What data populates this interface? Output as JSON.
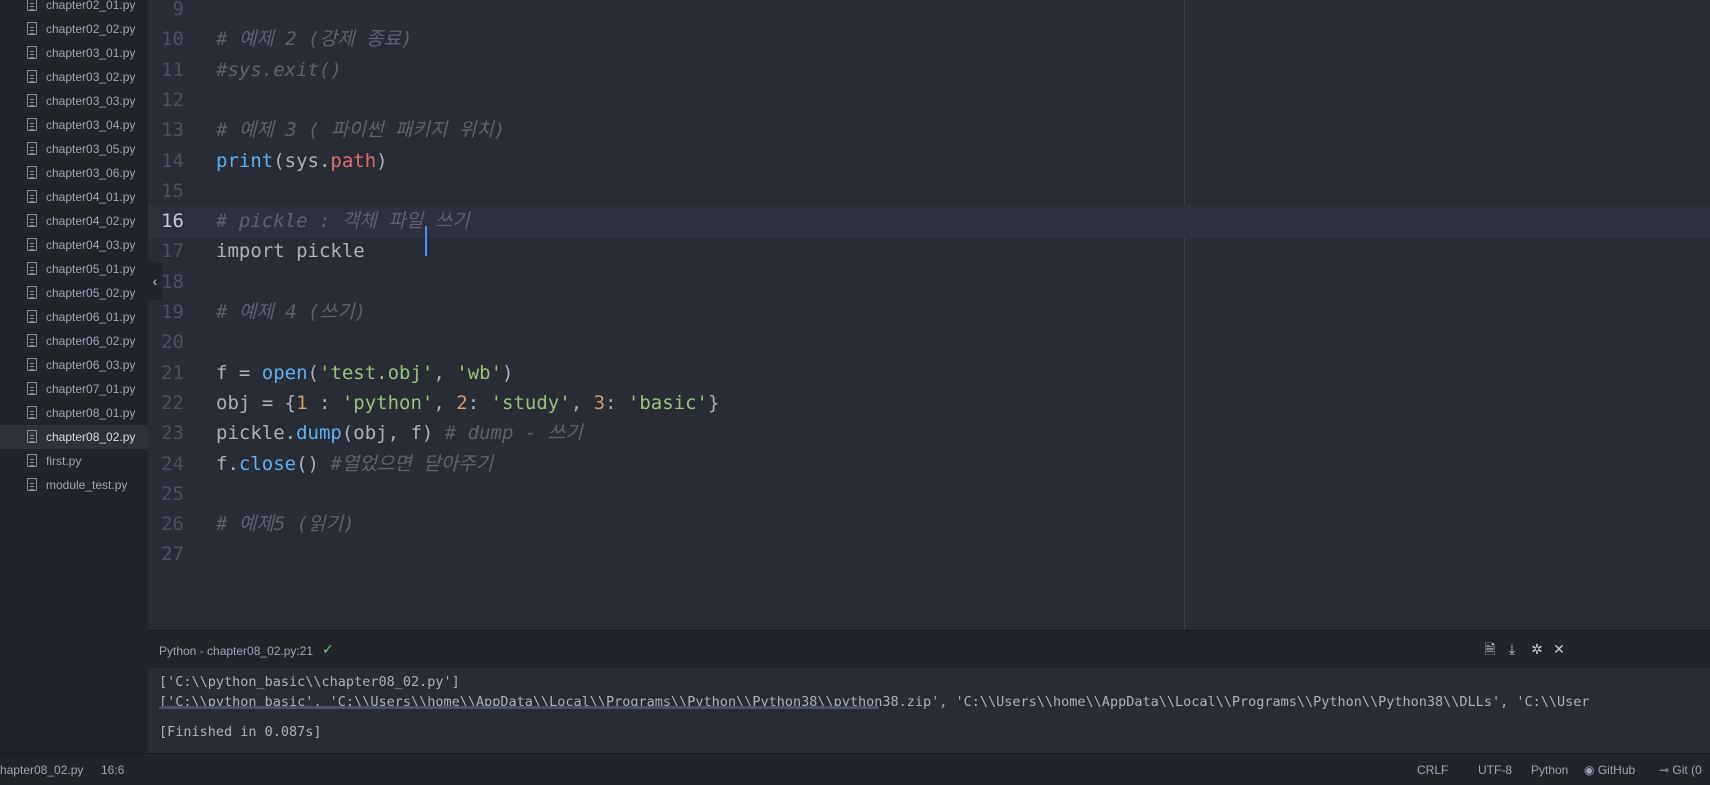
{
  "sidebar": {
    "files": [
      {
        "name": "chapter02_01.py",
        "selected": false
      },
      {
        "name": "chapter02_02.py",
        "selected": false
      },
      {
        "name": "chapter03_01.py",
        "selected": false
      },
      {
        "name": "chapter03_02.py",
        "selected": false
      },
      {
        "name": "chapter03_03.py",
        "selected": false
      },
      {
        "name": "chapter03_04.py",
        "selected": false
      },
      {
        "name": "chapter03_05.py",
        "selected": false
      },
      {
        "name": "chapter03_06.py",
        "selected": false
      },
      {
        "name": "chapter04_01.py",
        "selected": false
      },
      {
        "name": "chapter04_02.py",
        "selected": false
      },
      {
        "name": "chapter04_03.py",
        "selected": false
      },
      {
        "name": "chapter05_01.py",
        "selected": false
      },
      {
        "name": "chapter05_02.py",
        "selected": false
      },
      {
        "name": "chapter06_01.py",
        "selected": false
      },
      {
        "name": "chapter06_02.py",
        "selected": false
      },
      {
        "name": "chapter06_03.py",
        "selected": false
      },
      {
        "name": "chapter07_01.py",
        "selected": false
      },
      {
        "name": "chapter08_01.py",
        "selected": false
      },
      {
        "name": "chapter08_02.py",
        "selected": true
      },
      {
        "name": "first.py",
        "selected": false
      },
      {
        "name": "module_test.py",
        "selected": false
      }
    ],
    "collapse_icon": "chevron-left-icon"
  },
  "editor": {
    "cursor_line": 16,
    "lines": [
      {
        "n": "9",
        "t": []
      },
      {
        "n": "10",
        "t": [
          [
            "cm",
            "# 예제 2 (강제 종료)"
          ]
        ]
      },
      {
        "n": "11",
        "t": [
          [
            "cm",
            "#sys.exit()"
          ]
        ]
      },
      {
        "n": "12",
        "t": []
      },
      {
        "n": "13",
        "t": [
          [
            "cm",
            "# 예제 3 ( 파이썬 패키지 위치)"
          ]
        ]
      },
      {
        "n": "14",
        "t": [
          [
            "fn",
            "print"
          ],
          [
            "",
            "(sys."
          ],
          [
            "pr",
            "path"
          ],
          [
            "",
            ")"
          ]
        ]
      },
      {
        "n": "15",
        "t": []
      },
      {
        "n": "16",
        "t": [
          [
            "cm",
            "# pickle : 객체 파일 쓰기"
          ]
        ]
      },
      {
        "n": "17",
        "t": [
          [
            "",
            "import pickle"
          ]
        ]
      },
      {
        "n": "18",
        "t": []
      },
      {
        "n": "19",
        "t": [
          [
            "cm",
            "# 예제 4 (쓰기)"
          ]
        ]
      },
      {
        "n": "20",
        "t": []
      },
      {
        "n": "21",
        "t": [
          [
            "",
            "f = "
          ],
          [
            "fn",
            "open"
          ],
          [
            "",
            "("
          ],
          [
            "st",
            "'test.obj'"
          ],
          [
            "",
            ", "
          ],
          [
            "st",
            "'wb'"
          ],
          [
            "",
            ")"
          ]
        ]
      },
      {
        "n": "22",
        "t": [
          [
            "",
            "obj = {"
          ],
          [
            "nm",
            "1"
          ],
          [
            "",
            " : "
          ],
          [
            "st",
            "'python'"
          ],
          [
            "",
            ", "
          ],
          [
            "nm",
            "2"
          ],
          [
            "",
            ": "
          ],
          [
            "st",
            "'study'"
          ],
          [
            "",
            ", "
          ],
          [
            "nm",
            "3"
          ],
          [
            "",
            ": "
          ],
          [
            "st",
            "'basic'"
          ],
          [
            "",
            "}"
          ]
        ]
      },
      {
        "n": "23",
        "t": [
          [
            "",
            "pickle."
          ],
          [
            "fn",
            "dump"
          ],
          [
            "",
            "(obj, f) "
          ],
          [
            "cm",
            "# dump - 쓰기"
          ]
        ]
      },
      {
        "n": "24",
        "t": [
          [
            "",
            "f."
          ],
          [
            "fn",
            "close"
          ],
          [
            "",
            "() "
          ],
          [
            "cm",
            "#열었으면 닫아주기"
          ]
        ]
      },
      {
        "n": "25",
        "t": []
      },
      {
        "n": "26",
        "t": [
          [
            "cm",
            "# 예제5 (읽기)"
          ]
        ]
      },
      {
        "n": "27",
        "t": []
      }
    ]
  },
  "output_panel": {
    "title": "Python - chapter08_02.py:21",
    "status_icon": "check-icon",
    "buttons": [
      {
        "name": "open-output-in-tab-button",
        "glyph": "🗎"
      },
      {
        "name": "download-output-button",
        "glyph": "⤓"
      },
      {
        "name": "pin-panel-button",
        "glyph": "✲"
      },
      {
        "name": "close-panel-button",
        "glyph": "✕"
      }
    ],
    "output_lines": [
      "['C:\\\\python_basic\\\\chapter08_02.py']",
      "['C:\\\\python_basic', 'C:\\\\Users\\\\home\\\\AppData\\\\Local\\\\Programs\\\\Python\\\\Python38\\\\python38.zip', 'C:\\\\Users\\\\home\\\\AppData\\\\Local\\\\Programs\\\\Python\\\\Python38\\\\DLLs', 'C:\\\\User",
      "[Finished in 0.087s]"
    ]
  },
  "status_bar": {
    "file": "hapter08_02.py",
    "position": "16:6",
    "line_ending": "CRLF",
    "encoding": "UTF-8",
    "grammar": "Python",
    "github": "GitHub",
    "git": "Git (0"
  }
}
